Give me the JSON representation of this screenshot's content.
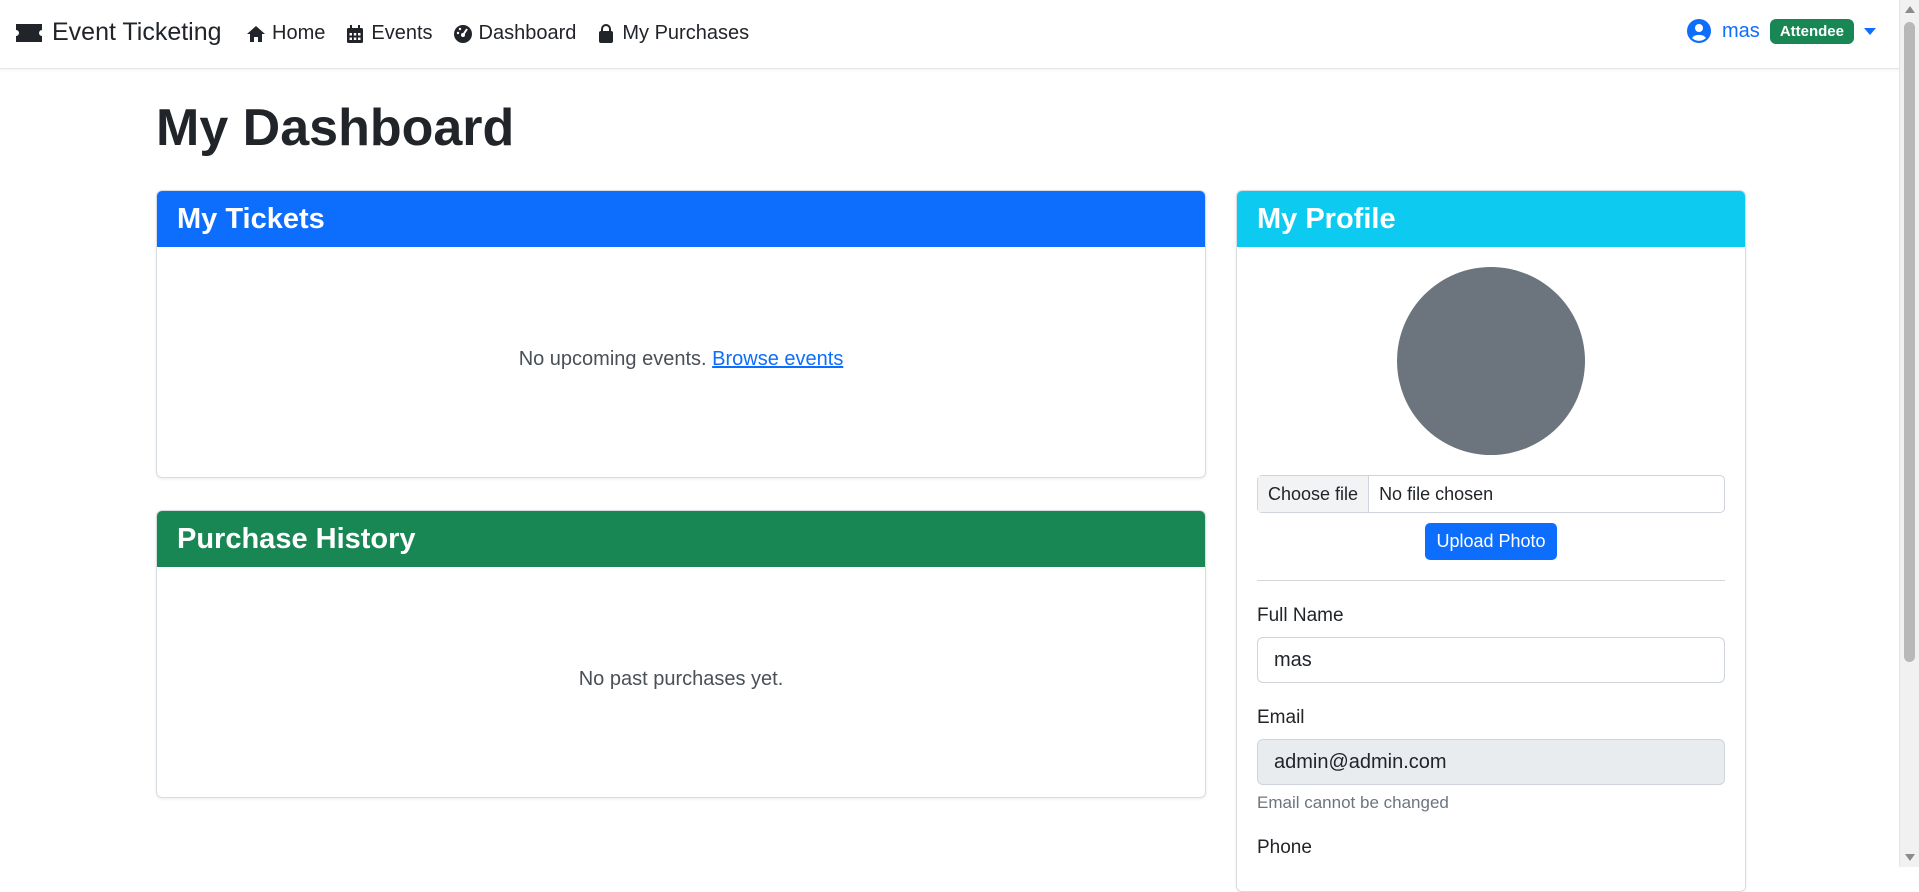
{
  "navbar": {
    "brand": "Event Ticketing",
    "items": [
      {
        "label": "Home",
        "icon": "home-icon"
      },
      {
        "label": "Events",
        "icon": "calendar-icon"
      },
      {
        "label": "Dashboard",
        "icon": "dashboard-icon"
      },
      {
        "label": "My Purchases",
        "icon": "shopping-bag-icon"
      }
    ],
    "user": {
      "name": "mas",
      "role": "Attendee"
    }
  },
  "page": {
    "title": "My Dashboard"
  },
  "tickets": {
    "header": "My Tickets",
    "empty_text": "No upcoming events.",
    "browse_link": "Browse events"
  },
  "history": {
    "header": "Purchase History",
    "empty_text": "No past purchases yet."
  },
  "profile": {
    "header": "My Profile",
    "file_button": "Choose file",
    "file_status": "No file chosen",
    "upload_button": "Upload Photo",
    "full_name_label": "Full Name",
    "full_name_value": "mas",
    "email_label": "Email",
    "email_value": "admin@admin.com",
    "email_help": "Email cannot be changed",
    "phone_label": "Phone"
  },
  "colors": {
    "primary": "#0d6efd",
    "success": "#198754",
    "info": "#0dcaf0",
    "avatar": "#6c757d"
  }
}
